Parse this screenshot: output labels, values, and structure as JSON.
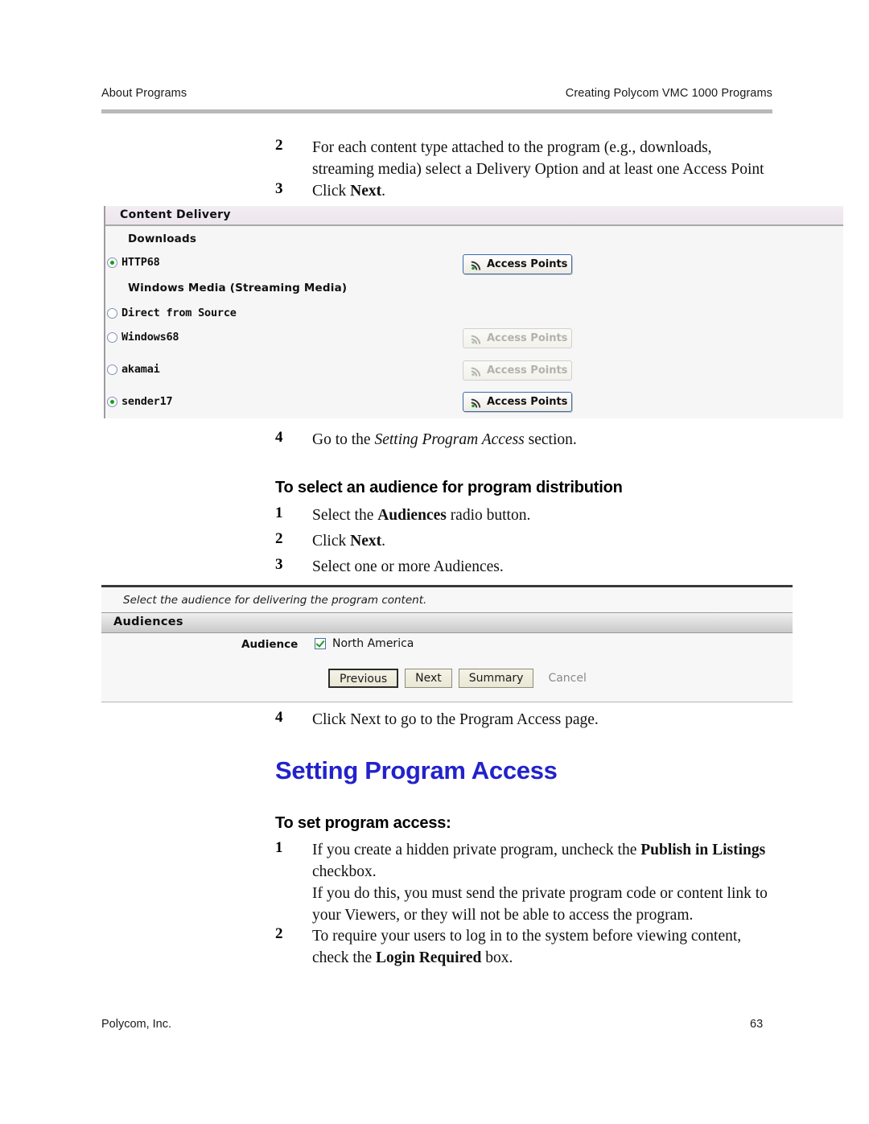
{
  "header": {
    "left": "About Programs",
    "right": "Creating Polycom VMC 1000 Programs"
  },
  "steps_top": [
    {
      "num": "2",
      "text": "For each content type attached to the program (e.g., downloads, streaming media) select a Delivery Option and at least one Access Point"
    },
    {
      "num": "3",
      "text_before": "Click ",
      "text_bold": "Next",
      "text_after": "."
    }
  ],
  "content_delivery": {
    "panel_title": "Content Delivery",
    "group_label": "Downloads",
    "group_label2": "Windows Media (Streaming Media)",
    "access_points_label": "Access Points",
    "icon": "wifi-signal-icon",
    "options": [
      {
        "label": "HTTP68",
        "selected": true,
        "has_button": true,
        "button_enabled": true
      },
      {
        "label": "Direct from Source",
        "selected": false,
        "has_button": false,
        "button_enabled": false
      },
      {
        "label": "Windows68",
        "selected": false,
        "has_button": true,
        "button_enabled": false
      },
      {
        "label": "akamai",
        "selected": false,
        "has_button": true,
        "button_enabled": false
      },
      {
        "label": "sender17",
        "selected": true,
        "has_button": true,
        "button_enabled": true
      }
    ]
  },
  "step4_a": {
    "num": "4",
    "text_before": "Go to the ",
    "text_italic": "Setting Program Access",
    "text_after": " section."
  },
  "heading_audience": "To select an audience for program distribution",
  "steps_audience": [
    {
      "num": "1",
      "before": "Select the ",
      "bold": "Audiences",
      "after": " radio button."
    },
    {
      "num": "2",
      "before": "Click ",
      "bold": "Next",
      "after": "."
    },
    {
      "num": "3",
      "before": "Select one or more Audiences.",
      "bold": "",
      "after": ""
    }
  ],
  "audiences_panel": {
    "intro": "Select the audience for delivering the program content.",
    "panel_title": "Audiences",
    "field_label": "Audience",
    "checkbox_label": "North America",
    "checkbox_checked": true,
    "buttons": [
      {
        "label": "Previous",
        "focused": true
      },
      {
        "label": "Next",
        "focused": false
      },
      {
        "label": "Summary",
        "focused": false
      }
    ],
    "cancel_label": "Cancel"
  },
  "step4_b": {
    "num": "4",
    "text": "Click Next to go to the Program Access page."
  },
  "heading_main": "Setting Program Access",
  "heading_setaccess": "To set program access:",
  "steps_access": [
    {
      "num": "1",
      "before": "If you create a hidden private program, uncheck the ",
      "bold": "Publish in Listings",
      "after": " checkbox."
    },
    {
      "num": "2",
      "before": "To require your users to log in to the system before viewing content, check the ",
      "bold": "Login Required",
      "after": " box."
    }
  ],
  "note_paragraph": "If you do this, you must send the private program code or content link to your Viewers, or they will not be able to access the program.",
  "footer": {
    "left": "Polycom, Inc.",
    "right": "63"
  },
  "colors": {
    "heading_blue": "#2222cc",
    "rule_grey": "#b9b9b9",
    "radio_green": "#17a017",
    "check_green": "#1c9a1c"
  }
}
